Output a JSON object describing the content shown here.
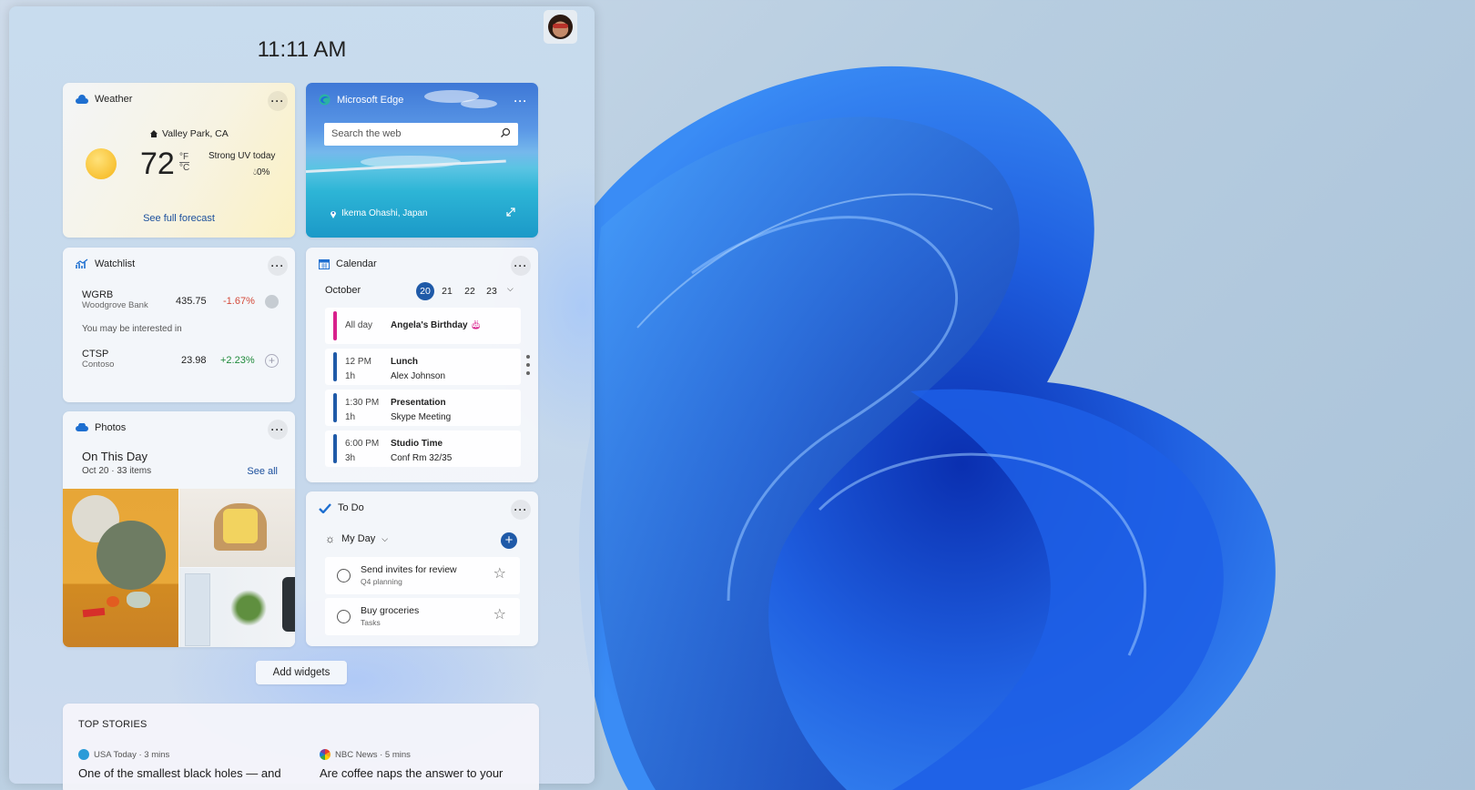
{
  "clock": "11:11 AM",
  "weather": {
    "title": "Weather",
    "location": "Valley Park, CA",
    "temp": "72",
    "unit_f": "°F",
    "unit_c": "°C",
    "condition": "Strong UV today",
    "rain": "0%",
    "forecast_link": "See full forecast"
  },
  "edge": {
    "title": "Microsoft Edge",
    "search_placeholder": "Search the web",
    "location": "Ikema Ohashi, Japan"
  },
  "watchlist": {
    "title": "Watchlist",
    "stocks": [
      {
        "symbol": "WGRB",
        "name": "Woodgrove Bank",
        "price": "435.75",
        "change": "-1.67%"
      },
      {
        "symbol": "CTSP",
        "name": "Contoso",
        "price": "23.98",
        "change": "+2.23%"
      }
    ],
    "interested": "You may be interested in"
  },
  "photos": {
    "title": "Photos",
    "heading": "On This Day",
    "sub": "Oct 20 · 33 items",
    "see_all": "See all"
  },
  "calendar": {
    "title": "Calendar",
    "month": "October",
    "days": [
      "20",
      "21",
      "22",
      "23"
    ],
    "events": [
      {
        "time": "All day",
        "duration": "",
        "title": "Angela's Birthday",
        "detail": "",
        "color": "#d8208c"
      },
      {
        "time": "12 PM",
        "duration": "1h",
        "title": "Lunch",
        "detail": "Alex  Johnson",
        "color": "#1f5aa8"
      },
      {
        "time": "1:30 PM",
        "duration": "1h",
        "title": "Presentation",
        "detail": "Skype Meeting",
        "color": "#1f5aa8"
      },
      {
        "time": "6:00 PM",
        "duration": "3h",
        "title": "Studio Time",
        "detail": "Conf Rm 32/35",
        "color": "#1f5aa8"
      }
    ]
  },
  "todo": {
    "title": "To Do",
    "list": "My Day",
    "tasks": [
      {
        "title": "Send invites for review",
        "sub": "Q4 planning"
      },
      {
        "title": "Buy groceries",
        "sub": "Tasks"
      }
    ]
  },
  "add_widgets": "Add widgets",
  "stories": {
    "title": "TOP STORIES",
    "items": [
      {
        "source": "USA Today · 3 mins",
        "headline": "One of the smallest black holes — and"
      },
      {
        "source": "NBC News · 5 mins",
        "headline": "Are coffee naps the answer to your"
      }
    ]
  },
  "colors": {
    "accent": "#1f5aa8",
    "link": "#1b4f9c",
    "negative": "#d44a3a",
    "positive": "#1f8a3b"
  }
}
